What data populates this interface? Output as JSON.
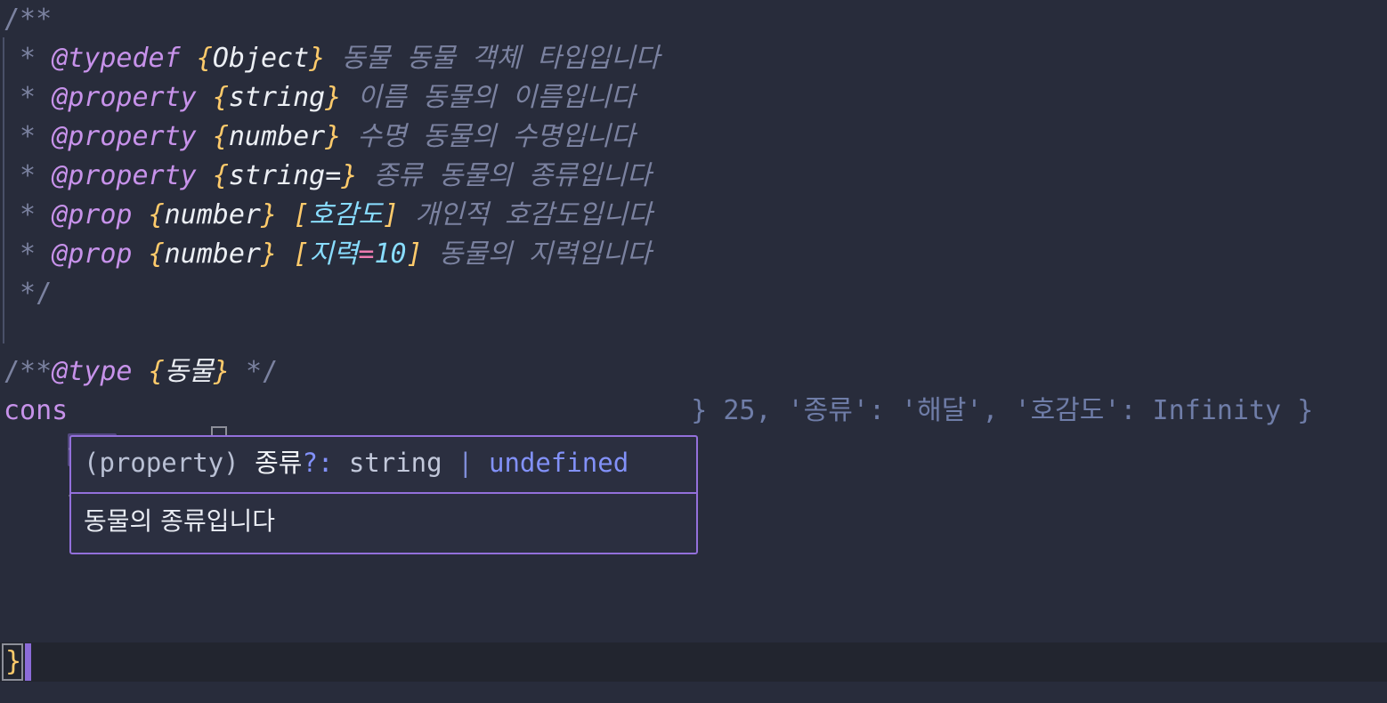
{
  "editor": {
    "theme_background": "#282c3b",
    "current_line_background": "#22252f",
    "caret_color": "#8b6bd8",
    "occurrence_highlight": "#52487e"
  },
  "jsdoc": {
    "open": "/**",
    "close": " */",
    "lines": [
      {
        "star": " * ",
        "tag": "@typedef",
        "brace_open": "{",
        "type": "Object",
        "brace_close": "}",
        "name": "동물",
        "description": "동물 객체 타입입니다"
      },
      {
        "star": " * ",
        "tag": "@property",
        "brace_open": "{",
        "type": "string",
        "brace_close": "}",
        "name": "이름",
        "description": "동물의 이름입니다"
      },
      {
        "star": " * ",
        "tag": "@property",
        "brace_open": "{",
        "type": "number",
        "brace_close": "}",
        "name": "수명",
        "description": "동물의 수명입니다"
      },
      {
        "star": " * ",
        "tag": "@property",
        "brace_open": "{",
        "type": "string=",
        "brace_close": "}",
        "name": "종류",
        "description": "동물의 종류입니다"
      },
      {
        "star": " * ",
        "tag": "@prop",
        "brace_open": "{",
        "type": "number",
        "brace_close": "}",
        "bracket_open": "[",
        "param": "호감도",
        "bracket_close": "]",
        "description": "개인적 호감도입니다"
      },
      {
        "star": " * ",
        "tag": "@prop",
        "brace_open": "{",
        "type": "number",
        "brace_close": "}",
        "bracket_open": "[",
        "param": "지력",
        "equals": "=",
        "default": "10",
        "bracket_close": "]",
        "description": "동물의 지력입니다"
      }
    ]
  },
  "type_annotation": {
    "comment_open": "/**",
    "tag": "@type",
    "brace_open": "{",
    "type": "동물",
    "brace_close": "}",
    "comment_close": " */"
  },
  "code": {
    "const_visible_prefix": "cons",
    "ghost_tail": "} 25, '종류': '해달', '호감도': Infinity }",
    "lines": [
      {
        "indent": "    ",
        "key": "종류",
        "colon": ": ",
        "value": "\"해달\"",
        "comma": ",",
        "highlighted": true
      },
      {
        "indent": "    ",
        "key": "호감도",
        "colon": ": ",
        "value": "Infinity",
        "comma": ",",
        "highlighted": false
      }
    ],
    "closing_brace": "}"
  },
  "tooltip": {
    "kind": "(property)",
    "name": "종류",
    "optional_marker": "?:",
    "type_primary": "string",
    "union_pipe": "|",
    "type_secondary": "undefined",
    "documentation": "동물의 종류입니다",
    "border_color": "#9370db",
    "background_color": "#2b2f40"
  }
}
